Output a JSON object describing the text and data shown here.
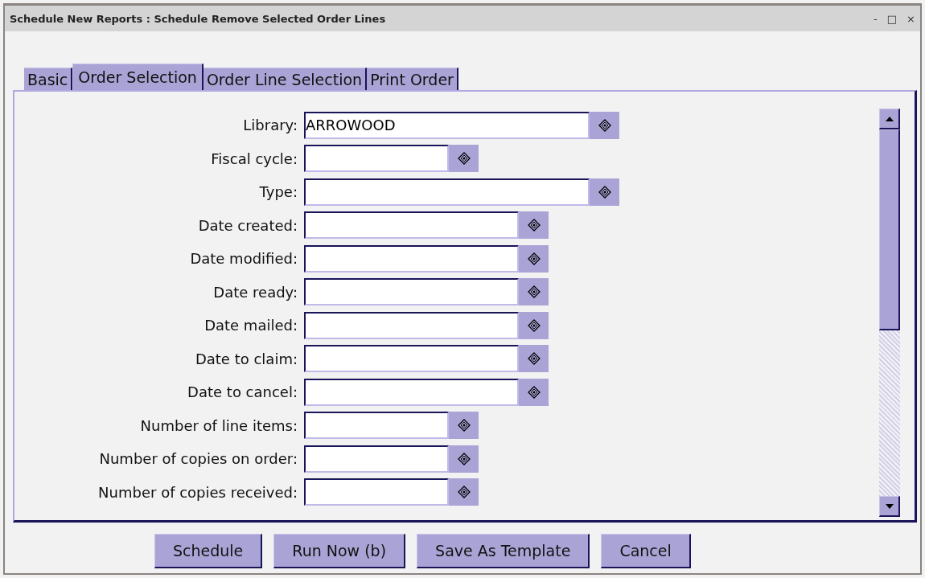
{
  "window": {
    "title": "Schedule New Reports : Schedule Remove Selected Order Lines",
    "controls": [
      "-",
      "□",
      "×"
    ]
  },
  "tabs": [
    {
      "label": "Basic",
      "selected": false
    },
    {
      "label": "Order Selection",
      "selected": true
    },
    {
      "label": "Order Line Selection",
      "selected": false
    },
    {
      "label": "Print Order",
      "selected": false
    }
  ],
  "fields": [
    {
      "label": "Library:",
      "value": "ARROWOOD",
      "kind": "wide"
    },
    {
      "label": "Fiscal cycle:",
      "kind": "short"
    },
    {
      "label": "Type:",
      "kind": "wide"
    },
    {
      "label": "Date created:",
      "kind": "medium"
    },
    {
      "label": "Date modified:",
      "kind": "medium"
    },
    {
      "label": "Date ready:",
      "kind": "medium"
    },
    {
      "label": "Date mailed:",
      "kind": "medium"
    },
    {
      "label": "Date to claim:",
      "kind": "medium"
    },
    {
      "label": "Date to cancel:",
      "kind": "medium"
    },
    {
      "label": "Number of line items:",
      "kind": "short"
    },
    {
      "label": "Number of copies on order:",
      "kind": "short"
    },
    {
      "label": "Number of copies received:",
      "kind": "short"
    }
  ],
  "buttons": [
    "Schedule",
    "Run Now (b)",
    "Save As Template",
    "Cancel"
  ]
}
